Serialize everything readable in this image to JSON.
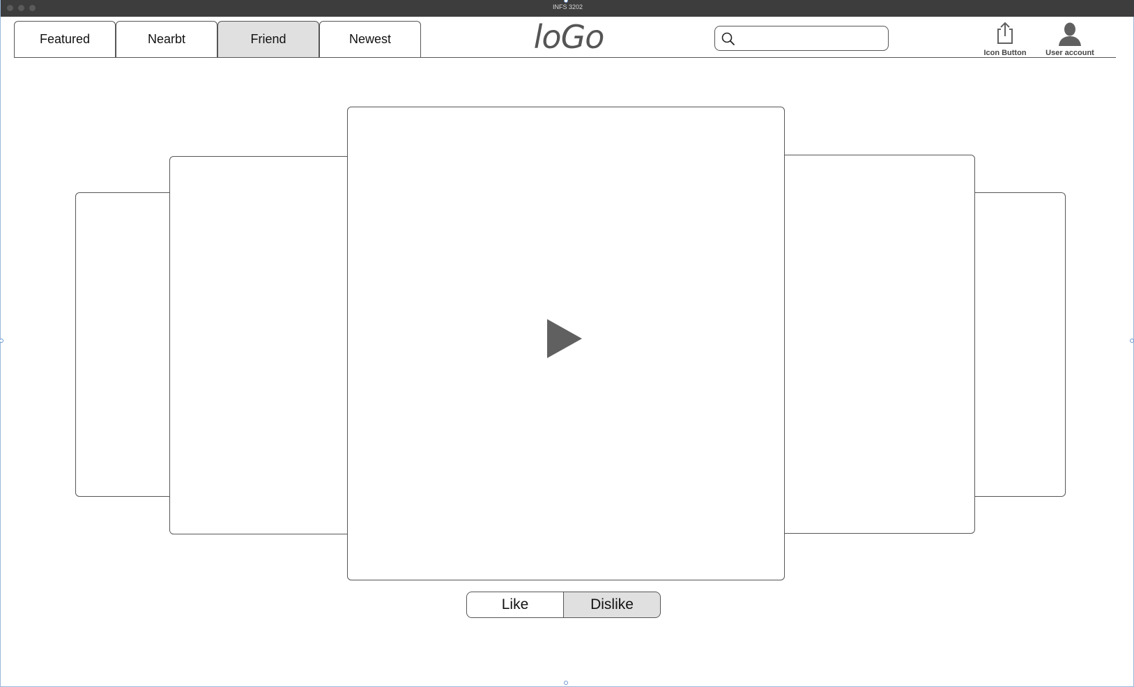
{
  "window": {
    "title": "INFS 3202"
  },
  "tabs": [
    {
      "label": "Featured",
      "active": false
    },
    {
      "label": "Nearbt",
      "active": false
    },
    {
      "label": "Friend",
      "active": true
    },
    {
      "label": "Newest",
      "active": false
    }
  ],
  "logo": {
    "text": "loGo"
  },
  "search": {
    "value": "",
    "placeholder": "",
    "icon": "magnifier-icon"
  },
  "header_actions": {
    "share": {
      "label": "Icon Button",
      "icon": "share-upload-icon"
    },
    "account": {
      "label": "User account",
      "icon": "user-silhouette-icon"
    }
  },
  "carousel": {
    "card_count": 5,
    "center_icon": "play-icon"
  },
  "vote": {
    "like_label": "Like",
    "dislike_label": "Dislike",
    "selected": "Dislike"
  },
  "colors": {
    "titlebar": "#3d3d3d",
    "active_fill": "#e0e0e0",
    "outline": "#555555",
    "icon_gray": "#606060",
    "selection_handle": "#6c97d0"
  }
}
